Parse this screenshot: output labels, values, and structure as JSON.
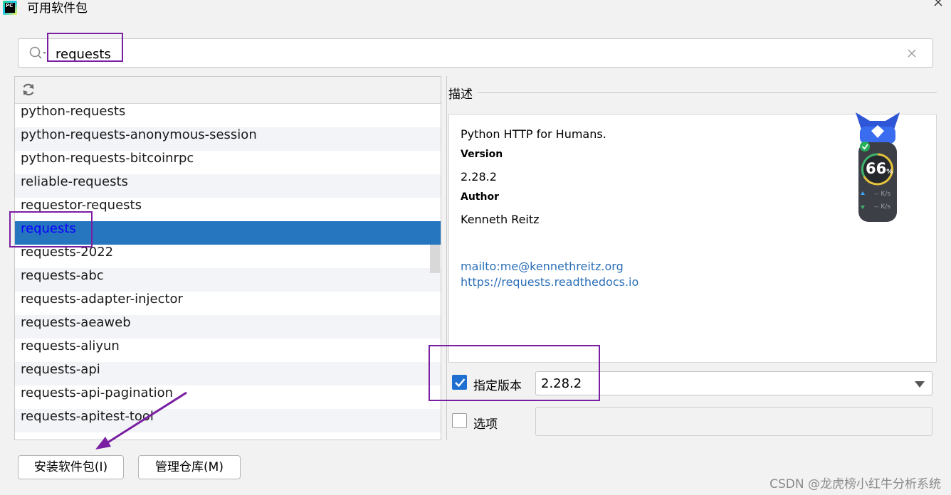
{
  "window": {
    "title": "可用软件包",
    "icon_label": "PC"
  },
  "search": {
    "value": "requests"
  },
  "packages": [
    "python-requests",
    "python-requests-anonymous-session",
    "python-requests-bitcoinrpc",
    "reliable-requests",
    "requestor-requests",
    "requests",
    "requests-2022",
    "requests-abc",
    "requests-adapter-injector",
    "requests-aeaweb",
    "requests-aliyun",
    "requests-api",
    "requests-api-pagination",
    "requests-apitest-tool"
  ],
  "selected_package": "requests",
  "description": {
    "section_label": "描述",
    "summary": "Python HTTP for Humans.",
    "version_key": "Version",
    "version_value": "2.28.2",
    "author_key": "Author",
    "author_value": "Kenneth Reitz",
    "email_link": "mailto:me@kennethreitz.org",
    "homepage_link": "https://requests.readthedocs.io"
  },
  "widget": {
    "percent": "66",
    "percent_unit": "%",
    "upload_rate": "-- K/s",
    "download_rate": "-- K/s"
  },
  "specify_version": {
    "label": "指定版本",
    "checked": true,
    "value": "2.28.2"
  },
  "options": {
    "label": "选项",
    "checked": false,
    "value": ""
  },
  "buttons": {
    "install": "安装软件包(I)",
    "manage_repos": "管理仓库(M)"
  },
  "watermark": "CSDN @龙虎榜小红牛分析系统",
  "colors": {
    "selection": "#2675bf",
    "selected_text": "#0a00ff",
    "link": "#2a6eb7",
    "annotation": "#7a1fa2",
    "checkbox_on": "#1f6fd1"
  }
}
